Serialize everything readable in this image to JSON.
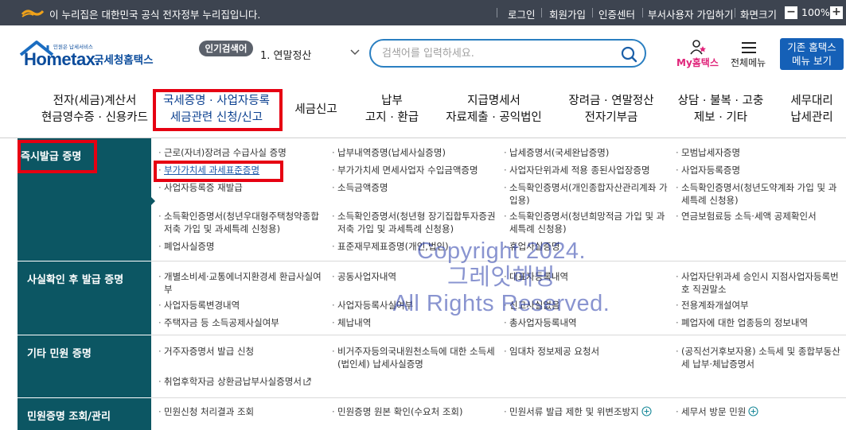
{
  "gov_bar": {
    "notice": "이 누리집은 대한민국 공식 전자정부 누리집입니다.",
    "links": [
      "로그인",
      "회원가입",
      "인증센터",
      "부서사용자 가입하기",
      "화면크기"
    ],
    "zoom_level": "100%"
  },
  "header": {
    "logo_tag": "민원은 납세서비스",
    "logo_brand": "Hometax.",
    "logo_sub": "국세청홈택스",
    "popular_badge": "인기검색어",
    "popular_item": "1.  연말정산",
    "search_placeholder": "검색어를 입력하세요.",
    "my_label": "My홈택스",
    "menu_label": "전체메뉴",
    "old_button": [
      "기존 홈택스",
      "메뉴 보기"
    ]
  },
  "nav": [
    [
      "전자(세금)계산서",
      "현금영수증 · 신용카드"
    ],
    [
      "국세증명 · 사업자등록",
      "세금관련 신청/신고"
    ],
    [
      "세금신고"
    ],
    [
      "납부",
      "고지 · 환급"
    ],
    [
      "지급명세서",
      "자료제출 · 공익법인"
    ],
    [
      "장려금 · 연말정산",
      "전자기부금"
    ],
    [
      "상담 · 불복 · 고충",
      "제보 · 기타"
    ],
    [
      "세무대리",
      "납세관리"
    ]
  ],
  "categories": [
    "즉시발급 증명",
    "사실확인 후 발급 증명",
    "기타 민원 증명",
    "민원증명 조회/관리"
  ],
  "section1": {
    "c1": [
      "근로(자녀)장려금 수급사실 증명",
      "부가가치세 과세표준증명",
      "사업자등록증 재발급",
      "소득확인증명서(청년우대형주택청약종합저축 가입 및 과세특례 신청용)",
      "폐업사실증명"
    ],
    "c2": [
      "납부내역증명(납세사실증명)",
      "부가가치세 면세사업자 수입금액증명",
      "소득금액증명",
      "소득확인증명서(청년형 장기집합투자증권저축 가입 및 과세특례 신청용)",
      "표준재무제표증명(개인,법인)"
    ],
    "c3": [
      "납세증명서(국세완납증명)",
      "사업자단위과세 적용 종된사업장증명",
      "소득확인증명서(개인종합자산관리계좌 가입용)",
      "소득확인증명서(청년희망적금 가입 및 과세특례 신청용)",
      "휴업사실증명"
    ],
    "c4": [
      "모범납세자증명",
      "사업자등록증명",
      "소득확인증명서(청년도약계좌 가입 및 과세특례 신청용)",
      "연금보험료등 소득·세액 공제확인서"
    ]
  },
  "section2": {
    "c1": [
      "개별소비세·교통에너지환경세 환급사실여부",
      "사업자등록변경내역",
      "주택자금 등 소득공제사실여부"
    ],
    "c2": [
      "공동사업자내역",
      "사업자등록사실여부",
      "체납내역"
    ],
    "c3": [
      "대표자등록내역",
      "신고사실없음",
      "총사업자등록내역"
    ],
    "c4": [
      "사업자단위과세 승인시 지점사업자등록번호 직권말소",
      "전용계좌개설여부",
      "폐업자에 대한 업종등의 정보내역"
    ]
  },
  "section3": {
    "c1": [
      "거주자증명서 발급 신청",
      "취업후학자금 상환금납부사실증명서"
    ],
    "c2": [
      "비거주자등의국내원천소득에 대한 소득세(법인세) 납세사실증명"
    ],
    "c3": [
      "임대차 정보제공 요청서"
    ],
    "c4": [
      "(공직선거후보자용) 소득세 및 종합부동산세 납부·체납증명서"
    ]
  },
  "section4": {
    "c1": [
      "민원신청 처리결과 조회"
    ],
    "c2": [
      "민원증명 원본 확인(수요처 조회)"
    ],
    "c3": [
      "민원서류 발급 제한 및 위변조방지"
    ],
    "c4": [
      "세무서 방문 민원"
    ]
  },
  "watermark": [
    "Copyright 2024.",
    "그레잇해빙",
    "All Rights Reserved."
  ],
  "colors": {
    "gov_bar": "#3d4450",
    "brand_blue": "#0b4c9c",
    "category_teal": "#0c5663",
    "highlight_red": "#e60012",
    "my_pink": "#e0247a"
  }
}
